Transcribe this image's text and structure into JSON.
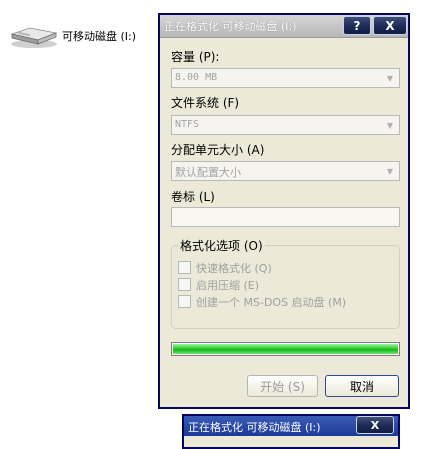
{
  "desktop": {
    "drive_label": "可移动磁盘 (I:)"
  },
  "dialog": {
    "title": "正在格式化 可移动磁盘 (I:)",
    "help_glyph": "?",
    "close_glyph": "X",
    "capacity": {
      "label": "容量 (P):",
      "value": "8.00 MB"
    },
    "filesystem": {
      "label": "文件系统 (F)",
      "value": "NTFS"
    },
    "allocation": {
      "label": "分配单元大小 (A)",
      "value": "默认配置大小"
    },
    "volume": {
      "label": "卷标 (L)",
      "value": ""
    },
    "format_options": {
      "title": "格式化选项 (O)",
      "options": [
        {
          "label": "快速格式化 (Q)",
          "checked": false,
          "enabled": false
        },
        {
          "label": "启用压缩 (E)",
          "checked": false,
          "enabled": false
        },
        {
          "label": "创建一个 MS-DOS 启动盘 (M)",
          "checked": false,
          "enabled": false
        }
      ]
    },
    "progress": 1.0,
    "buttons": {
      "start": "开始 (S)",
      "cancel": "取消"
    },
    "colors": {
      "progress_green": "#22c322",
      "titlebar_inactive": "#c4c4c4"
    }
  },
  "mini_window": {
    "title": "正在格式化 可移动磁盘 (I:)",
    "close_glyph": "X"
  }
}
